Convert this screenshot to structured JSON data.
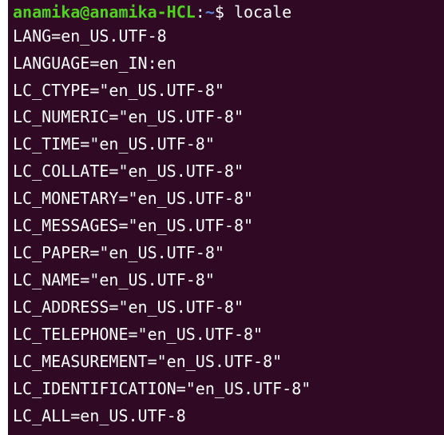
{
  "terminal": {
    "prompt": {
      "user_host": "anamika@anamika-HCL",
      "colon": ":",
      "path": "~",
      "symbol": "$ ",
      "command": "locale"
    },
    "output": [
      "LANG=en_US.UTF-8",
      "LANGUAGE=en_IN:en",
      "LC_CTYPE=\"en_US.UTF-8\"",
      "LC_NUMERIC=\"en_US.UTF-8\"",
      "LC_TIME=\"en_US.UTF-8\"",
      "LC_COLLATE=\"en_US.UTF-8\"",
      "LC_MONETARY=\"en_US.UTF-8\"",
      "LC_MESSAGES=\"en_US.UTF-8\"",
      "LC_PAPER=\"en_US.UTF-8\"",
      "LC_NAME=\"en_US.UTF-8\"",
      "LC_ADDRESS=\"en_US.UTF-8\"",
      "LC_TELEPHONE=\"en_US.UTF-8\"",
      "LC_MEASUREMENT=\"en_US.UTF-8\"",
      "LC_IDENTIFICATION=\"en_US.UTF-8\"",
      "LC_ALL=en_US.UTF-8"
    ],
    "colors": {
      "background": "#300a24",
      "text": "#ffffff",
      "user_host": "#4fd31f",
      "path": "#5b86d6"
    }
  }
}
